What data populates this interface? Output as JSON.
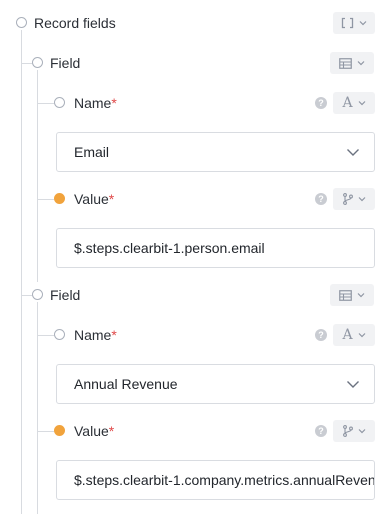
{
  "root": {
    "label": "Record fields",
    "type_icon": "list-brackets-icon"
  },
  "fields": [
    {
      "label": "Field",
      "type_icon": "table-icon",
      "name": {
        "label": "Name",
        "required": "*",
        "type_icon": "text-type-icon",
        "value": "Email"
      },
      "value": {
        "label": "Value",
        "required": "*",
        "type_icon": "branch-icon",
        "value": "$.steps.clearbit-1.person.email"
      }
    },
    {
      "label": "Field",
      "type_icon": "table-icon",
      "name": {
        "label": "Name",
        "required": "*",
        "type_icon": "text-type-icon",
        "value": "Annual Revenue"
      },
      "value": {
        "label": "Value",
        "required": "*",
        "type_icon": "branch-icon",
        "value": "$.steps.clearbit-1.company.metrics.annualReven"
      }
    }
  ],
  "colors": {
    "accent_filled_dot": "#f1a33c",
    "required": "#e04848"
  }
}
